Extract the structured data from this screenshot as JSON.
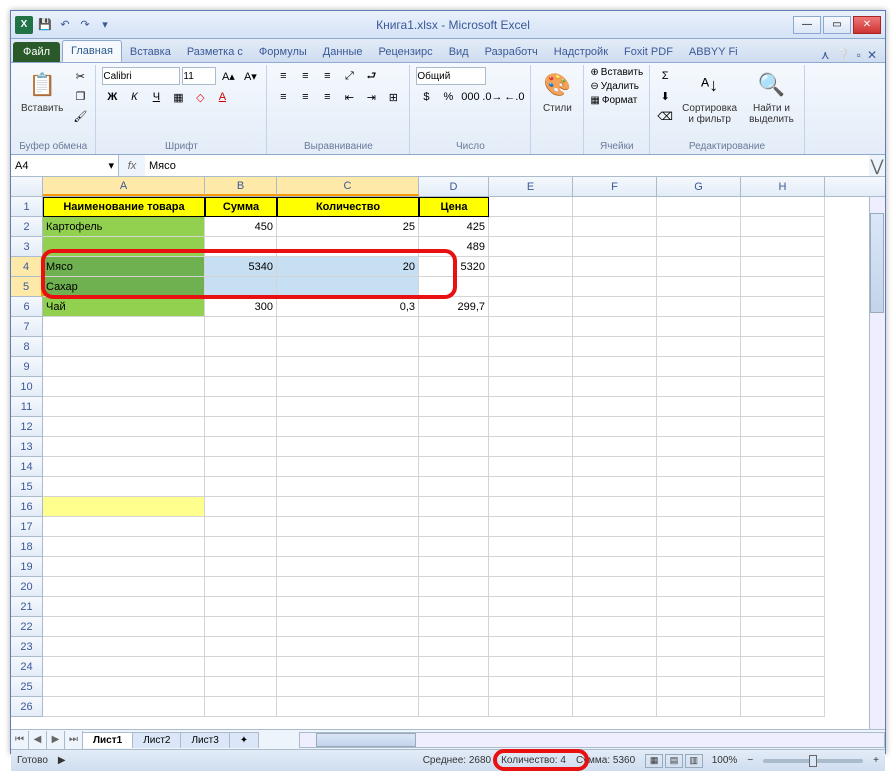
{
  "title": "Книга1.xlsx - Microsoft Excel",
  "qat": {
    "save": "💾",
    "undo": "↶",
    "redo": "↷"
  },
  "tabs": {
    "file": "Файл",
    "items": [
      "Главная",
      "Вставка",
      "Разметка с",
      "Формулы",
      "Данные",
      "Рецензирс",
      "Вид",
      "Разработч",
      "Надстройк",
      "Foxit PDF",
      "ABBYY Fi"
    ]
  },
  "ribbon": {
    "clipboard": {
      "paste": "Вставить",
      "label": "Буфер обмена"
    },
    "font": {
      "name": "Calibri",
      "size": "11",
      "label": "Шрифт"
    },
    "align": {
      "label": "Выравнивание"
    },
    "number": {
      "format": "Общий",
      "label": "Число"
    },
    "styles": {
      "btn": "Стили",
      "label": ""
    },
    "cells": {
      "insert": "Вставить",
      "delete": "Удалить",
      "format": "Формат",
      "label": "Ячейки"
    },
    "editing": {
      "sort": "Сортировка\nи фильтр",
      "find": "Найти и\nвыделить",
      "label": "Редактирование"
    }
  },
  "namebox": "A4",
  "formula": "Мясо",
  "columns": [
    "A",
    "B",
    "C",
    "D",
    "E",
    "F",
    "G",
    "H"
  ],
  "selectedCols": [
    "A",
    "B",
    "C"
  ],
  "selectedRows": [
    4,
    5
  ],
  "headers": {
    "A": "Наименование товара",
    "B": "Сумма",
    "C": "Количество",
    "D": "Цена"
  },
  "data": [
    {
      "A": "Картофель",
      "B": "450",
      "C": "25",
      "D": "425"
    },
    {
      "A": "",
      "B": "",
      "C": "",
      "D": "489"
    },
    {
      "A": "Мясо",
      "B": "5340",
      "C": "20",
      "D": "5320"
    },
    {
      "A": "Сахар",
      "B": "",
      "C": "",
      "D": ""
    },
    {
      "A": "Чай",
      "B": "300",
      "C": "0,3",
      "D": "299,7"
    }
  ],
  "sheets": [
    "Лист1",
    "Лист2",
    "Лист3"
  ],
  "status": {
    "ready": "Готово",
    "avg": "Среднее: 2680",
    "count": "Количество: 4",
    "sum": "Сумма: 5360",
    "zoom": "100%"
  }
}
